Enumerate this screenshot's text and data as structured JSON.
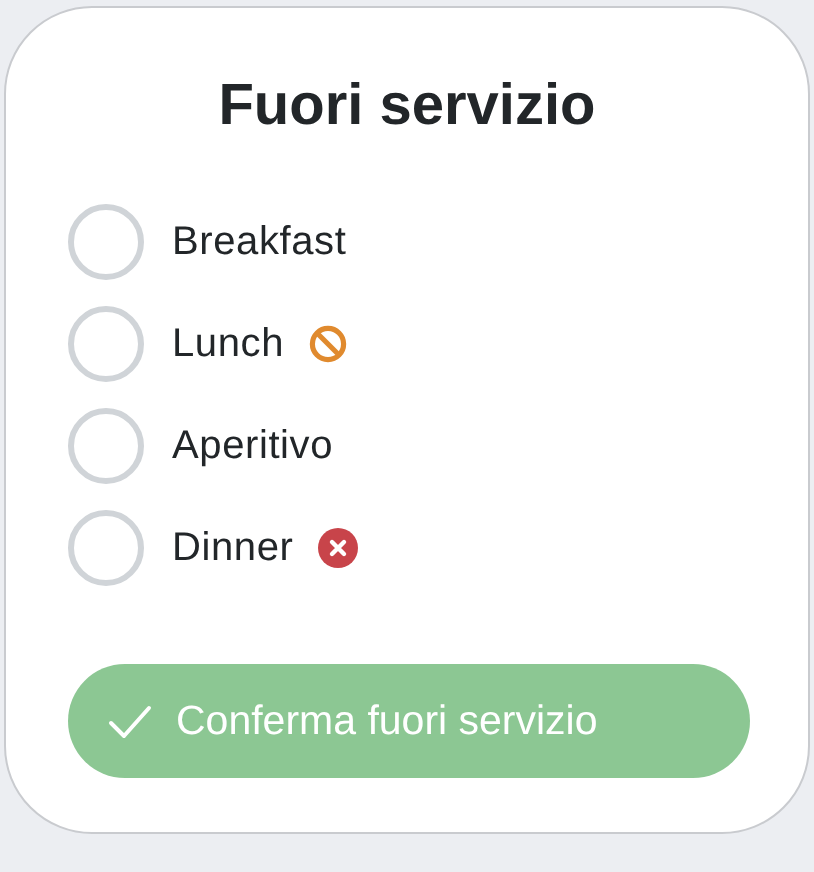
{
  "title": "Fuori servizio",
  "options": [
    {
      "label": "Breakfast",
      "selected": false,
      "kind": "plain"
    },
    {
      "label": "Lunch",
      "selected": false,
      "kind": "blocked"
    },
    {
      "label": "Aperitivo",
      "selected": false,
      "kind": "plain"
    },
    {
      "label": "Dinner",
      "selected": false,
      "kind": "closed"
    }
  ],
  "confirm_button": {
    "label": "Conferma fuori servizio",
    "disabled": true
  }
}
